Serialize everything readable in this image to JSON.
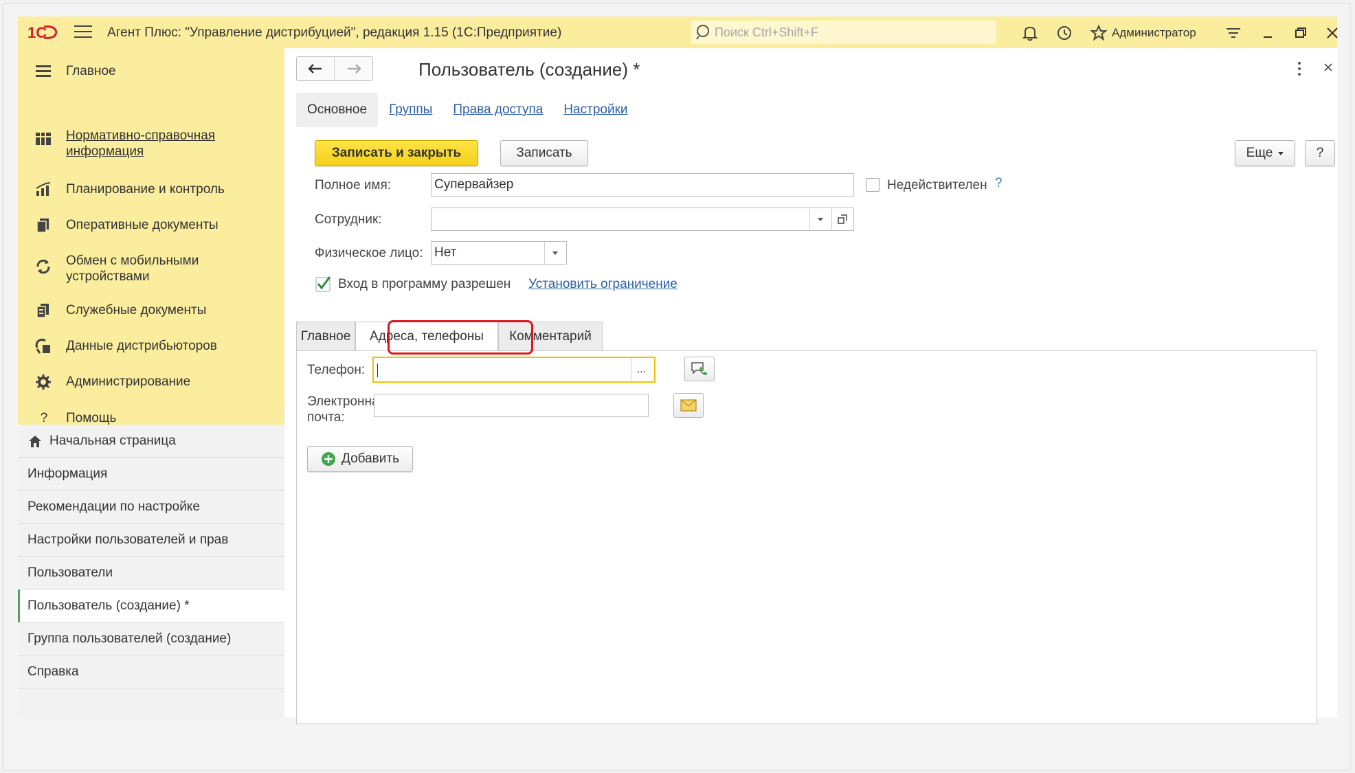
{
  "titlebar": {
    "logo_text": "1С",
    "app_title": "Агент Плюс: \"Управление дистрибуцией\", редакция 1.15  (1С:Предприятие)",
    "search_placeholder": "Поиск Ctrl+Shift+F",
    "user": "Администратор"
  },
  "sections": [
    {
      "label": "Главное",
      "icon": "hamburger-icon"
    },
    {
      "label": "Нормативно-справочная информация",
      "icon": "grid-icon",
      "link": true
    },
    {
      "label": "Планирование и контроль",
      "icon": "chart-icon"
    },
    {
      "label": "Оперативные документы",
      "icon": "documents-icon"
    },
    {
      "label": "Обмен с мобильными устройствами",
      "icon": "sync-icon"
    },
    {
      "label": "Служебные документы",
      "icon": "service-docs-icon"
    },
    {
      "label": "Данные дистрибьюторов",
      "icon": "distributor-icon"
    },
    {
      "label": "Администрирование",
      "icon": "gear-icon"
    },
    {
      "label": "Помощь",
      "icon": "question-icon"
    }
  ],
  "open_windows": [
    {
      "label": "Начальная страница",
      "icon": "home-icon"
    },
    {
      "label": "Информация"
    },
    {
      "label": "Рекомендации по настройке"
    },
    {
      "label": "Настройки пользователей и прав"
    },
    {
      "label": "Пользователи"
    },
    {
      "label": "Пользователь (создание) *",
      "active": true
    },
    {
      "label": "Группа пользователей (создание)"
    },
    {
      "label": "Справка"
    }
  ],
  "form": {
    "title": "Пользователь (создание) *",
    "tabs": [
      "Основное",
      "Группы",
      "Права доступа",
      "Настройки"
    ],
    "buttons": {
      "save_close": "Записать и закрыть",
      "save": "Записать",
      "more": "Еще",
      "help": "?"
    },
    "fields": {
      "full_name_label": "Полное имя:",
      "full_name_value": "Супервайзер",
      "inactive_label": "Недействителен",
      "inactive_help": "?",
      "employee_label": "Сотрудник:",
      "employee_value": "",
      "person_label": "Физическое лицо:",
      "person_value": "Нет",
      "login_allowed_label": "Вход в программу разрешен",
      "set_restriction_link": "Установить ограничение"
    },
    "inner_tabs": [
      "Главное",
      "Адреса, телефоны",
      "Комментарий"
    ],
    "contacts": {
      "phone_label": "Телефон:",
      "phone_value": "",
      "phone_more": "...",
      "email_label_1": "Электронная",
      "email_label_2": "почта:",
      "email_value": "",
      "add_label": "Добавить"
    }
  },
  "colors": {
    "accent_yellow": "#fbed9e",
    "primary_button": "#f5d119",
    "link_blue": "#2b5ea8",
    "highlight_red": "#e0141e",
    "active_green": "#57a35b"
  }
}
